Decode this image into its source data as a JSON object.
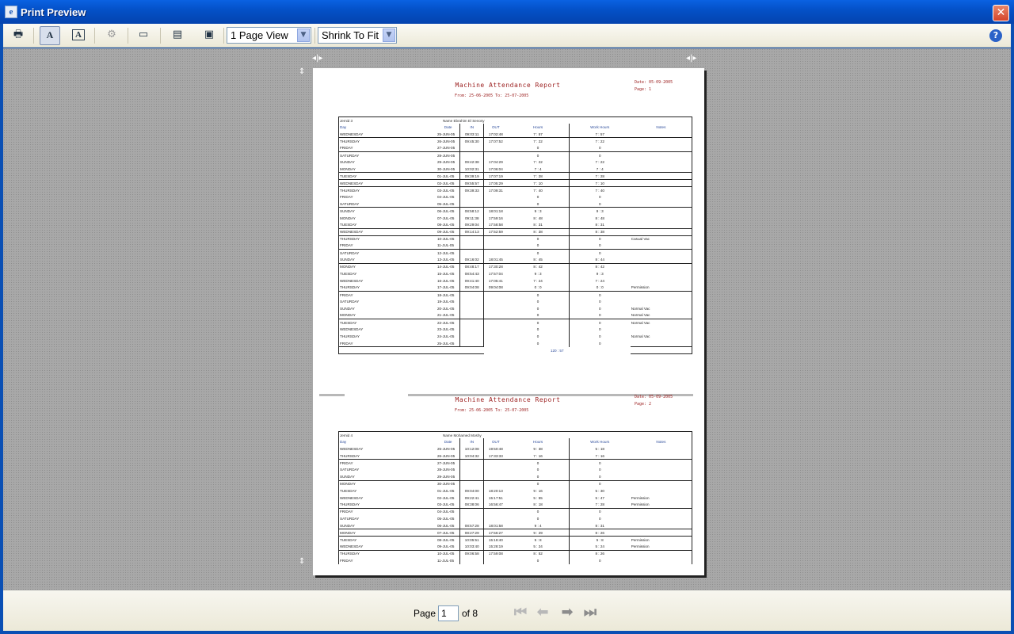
{
  "window": {
    "title": "Print Preview",
    "close_glyph": "✕"
  },
  "toolbar": {
    "print_icon": "printer-icon",
    "view_mode": "1 Page View",
    "view_mode_options": [
      "1 Page View"
    ],
    "zoom_mode": "Shrink To Fit",
    "zoom_mode_options": [
      "Shrink To Fit"
    ],
    "help_glyph": "?"
  },
  "report": {
    "title": "Machine Attendance Report",
    "headers": [
      "Day",
      "Date",
      "IN",
      "OUT",
      "Hours",
      "Work Hours",
      "Notes"
    ],
    "page1": {
      "date_line": "Date:  05-09-2005",
      "page_line": "Page:  1",
      "from_to": "From:  25-06-2005      To:  25-07-2005",
      "emp_id": "Jemid   3",
      "emp_name": "Name   Ebrahim El Senosy",
      "total": "120 : 57",
      "rows": [
        [
          "WEDNESDAY",
          "25-JUN-05",
          "09:03:11",
          "17:02:48",
          "7 : 57",
          "7 : 57",
          ""
        ],
        [
          "THURSDAY",
          "26-JUN-05",
          "09:45:30",
          "17:07:52",
          "7 : 22",
          "7 : 22",
          ""
        ],
        [
          "FRIDAY",
          "27-JUN-05",
          "",
          "",
          "0",
          "0",
          ""
        ],
        [
          "SATURDAY",
          "28-JUN-05",
          "",
          "",
          "0",
          "0",
          ""
        ],
        [
          "SUNDAY",
          "29-JUN-05",
          "09:42:38",
          "17:04:29",
          "7 : 22",
          "7 : 22",
          ""
        ],
        [
          "MONDAY",
          "30-JUN-05",
          "10:02:31",
          "17:06:04",
          "7 : 4",
          "7 : 4",
          ""
        ],
        [
          "TUESDAY",
          "01-JUL-05",
          "09:39:19",
          "17:07:19",
          "7 : 28",
          "7 : 28",
          ""
        ],
        [
          "WEDNESDAY",
          "02-JUL-05",
          "09:55:57",
          "17:05:29",
          "7 : 10",
          "7 : 10",
          ""
        ],
        [
          "THURSDAY",
          "03-JUL-05",
          "09:39:33",
          "17:09:31",
          "7 : 40",
          "7 : 40",
          ""
        ],
        [
          "FRIDAY",
          "04-JUL-05",
          "",
          "",
          "0",
          "0",
          ""
        ],
        [
          "SATURDAY",
          "05-JUL-05",
          "",
          "",
          "0",
          "0",
          ""
        ],
        [
          "SUNDAY",
          "06-JUL-05",
          "08:58:12",
          "18:01:18",
          "9 : 3",
          "9 : 3",
          ""
        ],
        [
          "MONDAY",
          "07-JUL-05",
          "09:11:38",
          "17:59:16",
          "8 : 48",
          "8 : 48",
          ""
        ],
        [
          "TUESDAY",
          "08-JUL-05",
          "09:29:04",
          "17:58:58",
          "8 : 31",
          "8 : 31",
          ""
        ],
        [
          "WEDNESDAY",
          "09-JUL-05",
          "09:14:13",
          "17:52:59",
          "8 : 38",
          "8 : 38",
          ""
        ],
        [
          "THURSDAY",
          "10-JUL-05",
          "",
          "",
          "0",
          "0",
          "Casual Vac"
        ],
        [
          "FRIDAY",
          "11-JUL-05",
          "",
          "",
          "0",
          "0",
          ""
        ],
        [
          "SATURDAY",
          "12-JUL-05",
          "",
          "",
          "0",
          "0",
          ""
        ],
        [
          "SUNDAY",
          "13-JUL-05",
          "09:16:02",
          "18:01:45",
          "8 : 45",
          "8 : 44",
          ""
        ],
        [
          "MONDAY",
          "14-JUL-05",
          "08:48:17",
          "17:30:28",
          "8 : 42",
          "8 : 42",
          ""
        ],
        [
          "TUESDAY",
          "15-JUL-05",
          "08:54:43",
          "17:57:04",
          "9 : 3",
          "9 : 3",
          ""
        ],
        [
          "WEDNESDAY",
          "16-JUL-05",
          "09:41:40",
          "17:05:41",
          "7 : 24",
          "7 : 24",
          ""
        ],
        [
          "THURSDAY",
          "17-JUL-05",
          "09:04:08",
          "09:04:08",
          "0 : 0",
          "0 : 0",
          "Permission"
        ],
        [
          "FRIDAY",
          "18-JUL-05",
          "",
          "",
          "0",
          "0",
          ""
        ],
        [
          "SATURDAY",
          "19-JUL-05",
          "",
          "",
          "0",
          "0",
          ""
        ],
        [
          "SUNDAY",
          "20-JUL-05",
          "",
          "",
          "0",
          "0",
          "Normal Vac"
        ],
        [
          "MONDAY",
          "21-JUL-05",
          "",
          "",
          "0",
          "0",
          "Normal Vac"
        ],
        [
          "TUESDAY",
          "22-JUL-05",
          "",
          "",
          "0",
          "0",
          "Normal Vac"
        ],
        [
          "WEDNESDAY",
          "23-JUL-05",
          "",
          "",
          "0",
          "0",
          ""
        ],
        [
          "THURSDAY",
          "24-JUL-05",
          "",
          "",
          "0",
          "0",
          "Normal Vac"
        ],
        [
          "FRIDAY",
          "25-JUL-05",
          "",
          "",
          "0",
          "0",
          ""
        ]
      ]
    },
    "page2": {
      "date_line": "Date:  05-09-2005",
      "page_line": "Page:  2",
      "from_to": "From:  25-06-2005      To:  25-07-2005",
      "emp_id": "Jemid   4",
      "emp_name": "Name   Mohamed Moshy",
      "rows": [
        [
          "WEDNESDAY",
          "25-JUN-05",
          "10:12:08",
          "19:50:48",
          "9 : 38",
          "5 : 18",
          ""
        ],
        [
          "THURSDAY",
          "26-JUN-05",
          "10:04:32",
          "17:33:33",
          "7 : 16",
          "7 : 16",
          ""
        ],
        [
          "FRIDAY",
          "27-JUN-05",
          "",
          "",
          "0",
          "0",
          ""
        ],
        [
          "SATURDAY",
          "28-JUN-05",
          "",
          "",
          "0",
          "0",
          ""
        ],
        [
          "SUNDAY",
          "29-JUN-05",
          "",
          "",
          "0",
          "0",
          ""
        ],
        [
          "MONDAY",
          "30-JUN-05",
          "",
          "",
          "0",
          "0",
          ""
        ],
        [
          "TUESDAY",
          "01-JUL-05",
          "09:04:00",
          "18:20:13",
          "9 : 16",
          "5 : 30",
          ""
        ],
        [
          "WEDNESDAY",
          "02-JUL-05",
          "09:22:41",
          "15:17:51",
          "5 : 55",
          "5 : 47",
          "Permission"
        ],
        [
          "THURSDAY",
          "03-JUL-05",
          "08:38:06",
          "16:56:47",
          "8 : 18",
          "7 : 28",
          "Permission"
        ],
        [
          "FRIDAY",
          "04-JUL-05",
          "",
          "",
          "0",
          "0",
          ""
        ],
        [
          "SATURDAY",
          "05-JUL-05",
          "",
          "",
          "0",
          "0",
          ""
        ],
        [
          "SUNDAY",
          "06-JUL-05",
          "08:57:28",
          "18:01:58",
          "9 : 4",
          "8 : 31",
          ""
        ],
        [
          "MONDAY",
          "07-JUL-05",
          "08:27:29",
          "17:56:27",
          "9 : 29",
          "8 : 26",
          ""
        ],
        [
          "TUESDAY",
          "08-JUL-05",
          "10:05:51",
          "15:18:40",
          "5 : 8",
          "5 : 8",
          "Permission"
        ],
        [
          "WEDNESDAY",
          "09-JUL-05",
          "10:03:40",
          "15:28:19",
          "5 : 24",
          "5 : 24",
          "Permission"
        ],
        [
          "THURSDAY",
          "10-JUL-05",
          "09:06:58",
          "17:59:08",
          "8 : 52",
          "8 : 26",
          ""
        ],
        [
          "FRIDAY",
          "11-JUL-05",
          "",
          "",
          "0",
          "0",
          ""
        ]
      ]
    }
  },
  "footer": {
    "page_label": "Page",
    "page_value": "1",
    "of_label": "of 8",
    "first_glyph": "⏮",
    "prev_glyph": "⬅",
    "next_glyph": "➡",
    "last_glyph": "⏭"
  }
}
